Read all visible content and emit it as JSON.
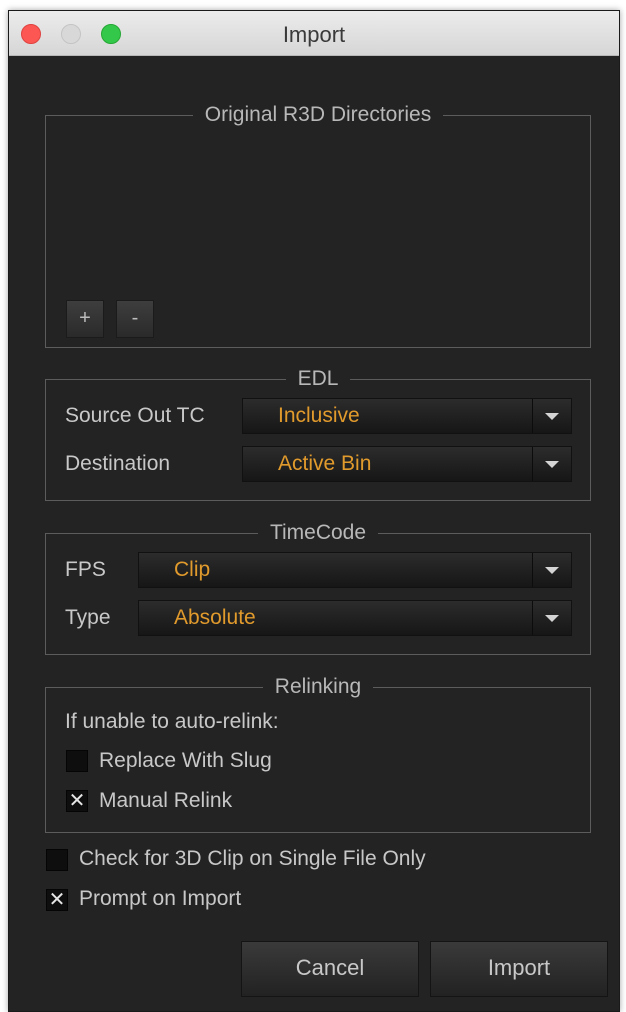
{
  "window": {
    "title": "Import"
  },
  "r3d": {
    "title": "Original R3D Directories",
    "add_label": "+",
    "remove_label": "-"
  },
  "edl": {
    "title": "EDL",
    "source_out_tc": {
      "label": "Source Out TC",
      "value": "Inclusive"
    },
    "destination": {
      "label": "Destination",
      "value": "Active Bin"
    }
  },
  "timecode": {
    "title": "TimeCode",
    "fps": {
      "label": "FPS",
      "value": "Clip"
    },
    "type": {
      "label": "Type",
      "value": "Absolute"
    }
  },
  "relinking": {
    "title": "Relinking",
    "note": "If unable to auto-relink:",
    "replace_with_slug": {
      "label": "Replace With Slug",
      "checked": false,
      "mark": ""
    },
    "manual_relink": {
      "label": "Manual Relink",
      "checked": true,
      "mark": "✕"
    }
  },
  "options": {
    "check_3d": {
      "label": "Check for 3D Clip on Single File Only",
      "checked": false,
      "mark": ""
    },
    "prompt_on_import": {
      "label": "Prompt on Import",
      "checked": true,
      "mark": "✕"
    }
  },
  "buttons": {
    "cancel": "Cancel",
    "import": "Import"
  },
  "colors": {
    "accent": "#e19a2c",
    "background": "#232323"
  }
}
